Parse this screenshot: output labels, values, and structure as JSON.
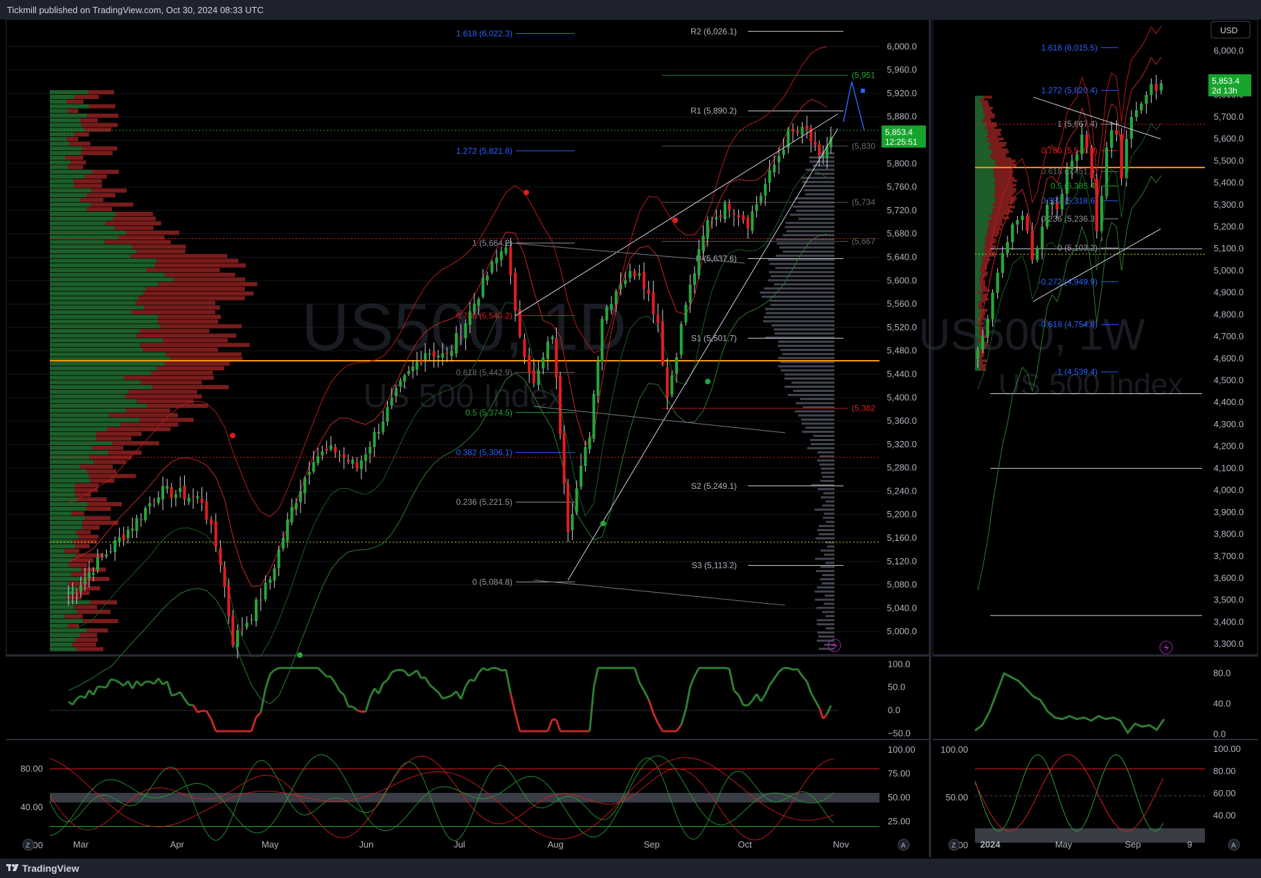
{
  "header": {
    "published_text": "Tickmill published on TradingView.com, Oct 30, 2024 08:33 UTC"
  },
  "footer": {
    "brand": "TradingView"
  },
  "colors": {
    "bull": "#26a63a",
    "bear": "#e21d1d",
    "panel_bg": "#000000",
    "frame": "#1e222d",
    "grid": "#1a1d26",
    "axis_text": "#b2b5be",
    "fib_blue": "#2962ff",
    "pivot_text": "#9598a1",
    "poc": "#ff9800",
    "price_badge": "#16a42c"
  },
  "icons": {
    "tv_logo": "tradingview-logo-icon",
    "lightning": "lightning-icon",
    "zoom": "zoom-icon",
    "auto": "auto-scale-icon"
  },
  "chart_data": [
    {
      "id": "daily",
      "type": "candlestick",
      "symbol_watermark": "US500, 1D",
      "description_watermark": "US 500 Index",
      "x_labels": [
        "Mar",
        "Apr",
        "May",
        "Jun",
        "Jul",
        "Aug",
        "Sep",
        "Oct",
        "Nov"
      ],
      "y_range": [
        4960,
        6030
      ],
      "y_ticks": [
        "6,000.0",
        "5,960.0",
        "5,920.0",
        "5,880.0",
        "5,840.0",
        "5,800.0",
        "5,760.0",
        "5,720.0",
        "5,680.0",
        "5,640.0",
        "5,600.0",
        "5,560.0",
        "5,520.0",
        "5,480.0",
        "5,440.0",
        "5,400.0",
        "5,360.0",
        "5,320.0",
        "5,280.0",
        "5,240.0",
        "5,200.0",
        "5,160.0",
        "5,120.0",
        "5,080.0",
        "5,040.0",
        "5,000.0"
      ],
      "last_price": "5,853.4",
      "countdown": "12:25:51",
      "close_path": [
        {
          "date": "2024-02-26",
          "close": 5060
        },
        {
          "date": "2024-03-05",
          "close": 5110
        },
        {
          "date": "2024-03-12",
          "close": 5150
        },
        {
          "date": "2024-03-19",
          "close": 5190
        },
        {
          "date": "2024-03-26",
          "close": 5240
        },
        {
          "date": "2024-04-02",
          "close": 5235
        },
        {
          "date": "2024-04-09",
          "close": 5225
        },
        {
          "date": "2024-04-15",
          "close": 5120
        },
        {
          "date": "2024-04-19",
          "close": 4985
        },
        {
          "date": "2024-04-25",
          "close": 5030
        },
        {
          "date": "2024-05-01",
          "close": 5090
        },
        {
          "date": "2024-05-08",
          "close": 5210
        },
        {
          "date": "2024-05-15",
          "close": 5300
        },
        {
          "date": "2024-05-22",
          "close": 5310
        },
        {
          "date": "2024-05-29",
          "close": 5280
        },
        {
          "date": "2024-06-05",
          "close": 5350
        },
        {
          "date": "2024-06-12",
          "close": 5420
        },
        {
          "date": "2024-06-20",
          "close": 5480
        },
        {
          "date": "2024-06-27",
          "close": 5470
        },
        {
          "date": "2024-07-03",
          "close": 5530
        },
        {
          "date": "2024-07-10",
          "close": 5610
        },
        {
          "date": "2024-07-16",
          "close": 5665
        },
        {
          "date": "2024-07-19",
          "close": 5540
        },
        {
          "date": "2024-07-25",
          "close": 5420
        },
        {
          "date": "2024-07-31",
          "close": 5510
        },
        {
          "date": "2024-08-05",
          "close": 5180
        },
        {
          "date": "2024-08-12",
          "close": 5340
        },
        {
          "date": "2024-08-16",
          "close": 5540
        },
        {
          "date": "2024-08-22",
          "close": 5600
        },
        {
          "date": "2024-08-28",
          "close": 5620
        },
        {
          "date": "2024-09-03",
          "close": 5530
        },
        {
          "date": "2024-09-06",
          "close": 5400
        },
        {
          "date": "2024-09-12",
          "close": 5560
        },
        {
          "date": "2024-09-19",
          "close": 5700
        },
        {
          "date": "2024-09-26",
          "close": 5730
        },
        {
          "date": "2024-10-02",
          "close": 5700
        },
        {
          "date": "2024-10-09",
          "close": 5780
        },
        {
          "date": "2024-10-15",
          "close": 5850
        },
        {
          "date": "2024-10-21",
          "close": 5855
        },
        {
          "date": "2024-10-25",
          "close": 5805
        },
        {
          "date": "2024-10-30",
          "close": 5853
        }
      ],
      "fib_levels": [
        {
          "label": "1.618 (6,022.3)",
          "value": 6022.3,
          "color": "#2962ff"
        },
        {
          "label": "1.272 (5,821.8)",
          "value": 5821.8,
          "color": "#2962ff"
        },
        {
          "label": "1 (5,664.2)",
          "value": 5664.2,
          "color": "#9598a1"
        },
        {
          "label": "0.786 (5,540.2)",
          "value": 5540.2,
          "color": "#e21d1d"
        },
        {
          "label": "0.618 (5,442.9)",
          "value": 5442.9,
          "color": "#6b6b6b"
        },
        {
          "label": "0.5 (5,374.5)",
          "value": 5374.5,
          "color": "#26a63a"
        },
        {
          "label": "0.382 (5,306.1)",
          "value": 5306.1,
          "color": "#2962ff"
        },
        {
          "label": "0.236 (5,221.5)",
          "value": 5221.5,
          "color": "#9598a1"
        },
        {
          "label": "0 (5,084.8)",
          "value": 5084.8,
          "color": "#9598a1"
        }
      ],
      "pivots": [
        {
          "label": "R2 (6,026.1)",
          "value": 6026.1
        },
        {
          "label": "R1 (5,890.2)",
          "value": 5890.2
        },
        {
          "label": "P (5,637.6)",
          "value": 5637.6
        },
        {
          "label": "S1 (5,501.7)",
          "value": 5501.7
        },
        {
          "label": "S2 (5,249.1)",
          "value": 5249.1
        },
        {
          "label": "S3 (5,113.2)",
          "value": 5113.2
        }
      ],
      "right_labels": [
        {
          "label": "(5,951",
          "value": 5951,
          "color": "#26a63a"
        },
        {
          "label": "(5,830",
          "value": 5830,
          "color": "#6b6b6b"
        },
        {
          "label": "(5,734",
          "value": 5734,
          "color": "#6b6b6b"
        },
        {
          "label": "(5,667",
          "value": 5667,
          "color": "#6b6b6b"
        },
        {
          "label": "(5,382",
          "value": 5382,
          "color": "#e21d1d"
        }
      ],
      "poc_value": 5463,
      "dotted_levels": [
        {
          "value": 5672,
          "color": "#e21d1d"
        },
        {
          "value": 5298,
          "color": "#e21d1d"
        },
        {
          "value": 5153,
          "color": "#cddc39"
        },
        {
          "value": 5857,
          "color": "#26a63a"
        }
      ]
    },
    {
      "id": "daily-momentum",
      "type": "line",
      "y_ticks": [
        "100.0",
        "50.0",
        "0.0",
        "−50.0"
      ],
      "y_range": [
        -60,
        105
      ]
    },
    {
      "id": "daily-stochastic",
      "type": "line",
      "y_ticks_left": [
        "80.00",
        "40.00",
        "0.00"
      ],
      "y_ticks_right": [
        "100.00",
        "75.00",
        "50.00",
        "25.00"
      ],
      "y_range": [
        -5,
        105
      ]
    },
    {
      "id": "weekly",
      "type": "candlestick",
      "symbol_watermark": "US500, 1W",
      "description_watermark": "US 500 Index",
      "currency": "USD",
      "x_labels": [
        "2024",
        "May",
        "Sep",
        "9"
      ],
      "y_range": [
        3250,
        6100
      ],
      "y_ticks": [
        "6,000.0",
        "5,800.0",
        "5,700.0",
        "5,600.0",
        "5,500.0",
        "5,400.0",
        "5,300.0",
        "5,200.0",
        "5,100.0",
        "5,000.0",
        "4,900.0",
        "4,800.0",
        "4,700.0",
        "4,600.0",
        "4,500.0",
        "4,400.0",
        "4,300.0",
        "4,200.0",
        "4,100.0",
        "4,000.0",
        "3,900.0",
        "3,800.0",
        "3,700.0",
        "3,600.0",
        "3,500.0",
        "3,400.0",
        "3,300.0"
      ],
      "last_price": "5,853.4",
      "countdown": "2d 13h",
      "fib_levels": [
        {
          "label": "1.618 (6,015.5)",
          "value": 6015.5,
          "color": "#2962ff"
        },
        {
          "label": "1.272 (5,820.4)",
          "value": 5820.4,
          "color": "#2962ff"
        },
        {
          "label": "1 (5,667.4)",
          "value": 5667.4,
          "color": "#9598a1"
        },
        {
          "label": "0.786 (5,546.4)",
          "value": 5546.4,
          "color": "#e21d1d"
        },
        {
          "label": "0.618 (5,451.9)",
          "value": 5451.9,
          "color": "#6b6b6b"
        },
        {
          "label": "0.5 (5,385.4)",
          "value": 5385.4,
          "color": "#26a63a"
        },
        {
          "label": "0.382 (5,318.6)",
          "value": 5318.6,
          "color": "#2962ff"
        },
        {
          "label": "0.236 (5,236.3)",
          "value": 5236.3,
          "color": "#9598a1"
        },
        {
          "label": "0 (5,103.2)",
          "value": 5103.2,
          "color": "#9598a1"
        },
        {
          "label": "-0.272 (4,949.9)",
          "value": 4949.9,
          "color": "#2962ff"
        },
        {
          "label": "-0.618 (4,754.8)",
          "value": 4754.8,
          "color": "#2962ff"
        },
        {
          "label": "-1 (4,539.4)",
          "value": 4539.4,
          "color": "#2962ff"
        }
      ]
    },
    {
      "id": "weekly-momentum",
      "type": "line",
      "y_ticks": [
        "80.0",
        "40.0",
        "0.0"
      ],
      "y_range": [
        -5,
        95
      ]
    },
    {
      "id": "weekly-stochastic",
      "type": "line",
      "y_ticks_left": [
        "100.00",
        "50.00",
        "0.00"
      ],
      "y_ticks_right": [
        "100.00",
        "80.00",
        "60.00",
        "40.00"
      ],
      "y_range": [
        -5,
        105
      ]
    }
  ]
}
